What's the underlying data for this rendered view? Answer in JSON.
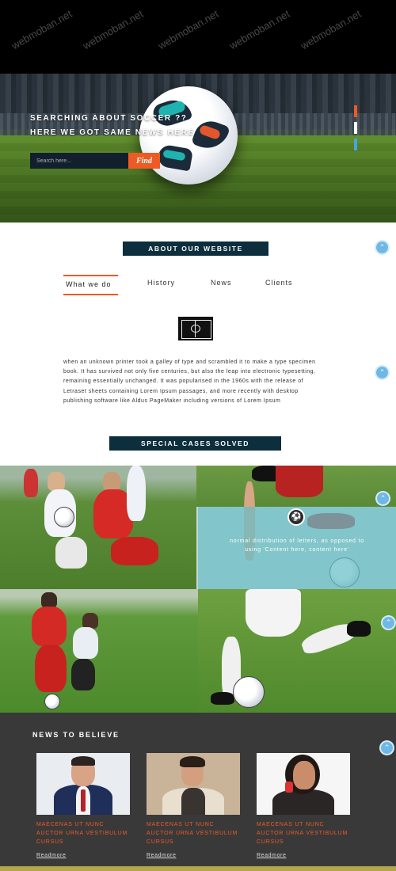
{
  "hero": {
    "line1": "SEARCHING ABOUT Soccer ??",
    "line2": "HERE WE GOT SAME NEWS HERE",
    "search_placeholder": "Search here...",
    "find_label": "Find",
    "slider_dots": [
      {
        "name": "slide-1",
        "color": "#ee5a24"
      },
      {
        "name": "slide-2",
        "color": "#ffffff"
      },
      {
        "name": "slide-3",
        "color": "#4aa3df"
      }
    ]
  },
  "about": {
    "title": "ABOUT OUR WEBSITE",
    "tabs": [
      "What we do",
      "History",
      "News",
      "Clients"
    ],
    "active_tab": "What we do",
    "icon": "soccer-field-icon",
    "body": "when an unknown printer took a galley of type and scrambled it to make a type specimen book. It has survived not only five centuries, but also the leap into electronic typesetting, remaining essentially unchanged. It was popularised in the 1960s with the release of Letraset sheets containing Lorem Ipsum passages, and more recently with desktop publishing software like Aldus PageMaker including versions of Lorem Ipsum"
  },
  "cases": {
    "title": "SPECIAL CASES SOLVED",
    "overlay_icon": "soccer-ball-icon",
    "overlay_text": "normal distribution of letters, as opposed to using 'Content here, content here'"
  },
  "news": {
    "title": "NEWS TO BELIEVE",
    "cards": [
      {
        "headline": "MAECENAS UT NUNC AUCTOR URNA VESTIBULUM CURSUS",
        "link": "Readmore"
      },
      {
        "headline": "MAECENAS UT NUNC AUCTOR URNA VESTIBULUM CURSUS",
        "link": "Readmore"
      },
      {
        "headline": "MAECENAS UT NUNC AUCTOR URNA VESTIBULUM CURSUS",
        "link": "Readmore"
      }
    ]
  },
  "watermark": "webmoban.net",
  "colors": {
    "accent": "#ee5a24",
    "navy": "#0d2e3c",
    "teal_overlay": "#67bec8",
    "news_bg": "#3a393a",
    "scroll_button": "#6fb8e6"
  },
  "scroll_icon": "chevron-up-icon"
}
